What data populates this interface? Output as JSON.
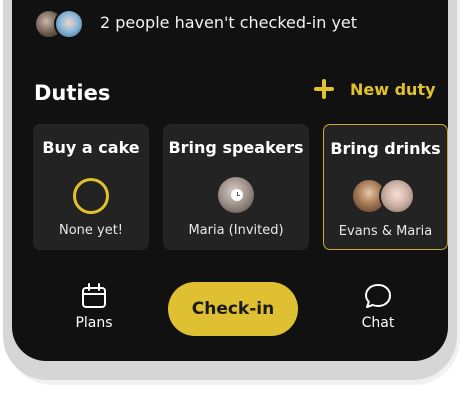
{
  "notice": {
    "text": "2 people haven't checked-in yet"
  },
  "duties": {
    "title": "Duties",
    "new_duty_label": "New duty",
    "cards": [
      {
        "title": "Buy a cake",
        "assignee": "None yet!"
      },
      {
        "title": "Bring speakers",
        "assignee": "Maria (Invited)"
      },
      {
        "title": "Bring drinks",
        "assignee": "Evans & Maria"
      }
    ]
  },
  "bottom_nav": {
    "plans_label": "Plans",
    "checkin_label": "Check-in",
    "chat_label": "Chat"
  },
  "colors": {
    "accent": "#dfc032",
    "background": "#111111",
    "card": "#232323"
  },
  "icons": {
    "plans": "calendar-icon",
    "chat": "chat-bubble-icon",
    "new_duty": "plus-icon"
  }
}
